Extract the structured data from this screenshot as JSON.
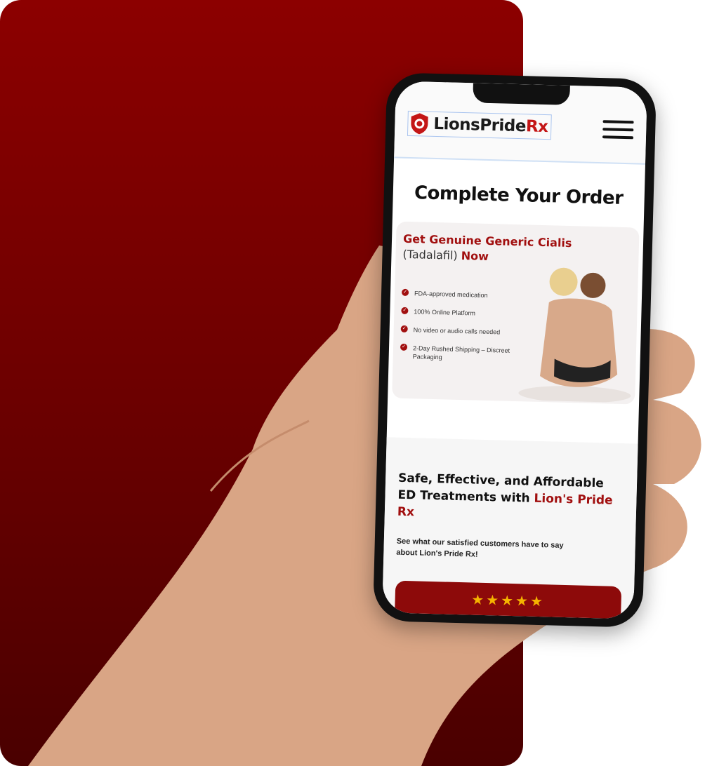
{
  "header": {
    "brand_main": "LionsPride",
    "brand_accent": "Rx"
  },
  "page": {
    "title": "Complete Your Order"
  },
  "offer": {
    "headline_red_1": "Get Genuine Generic Cialis",
    "headline_plain": "(Tadalafil) ",
    "headline_red_2": "Now",
    "features": [
      "FDA-approved medication",
      "100% Online Platform",
      "No video or audio calls needed",
      "2-Day Rushed Shipping – Discreet Packaging"
    ]
  },
  "testimonials": {
    "heading_plain": "Safe, Effective, and Affordable ED Treatments with ",
    "heading_red": "Lion's Pride Rx",
    "subtitle": "See what our satisfied customers have to say about Lion's Pride Rx!",
    "stars": "★★★★★"
  },
  "colors": {
    "brand_red": "#a10f0f",
    "background_red": "#8c0000",
    "star": "#f5b400"
  }
}
